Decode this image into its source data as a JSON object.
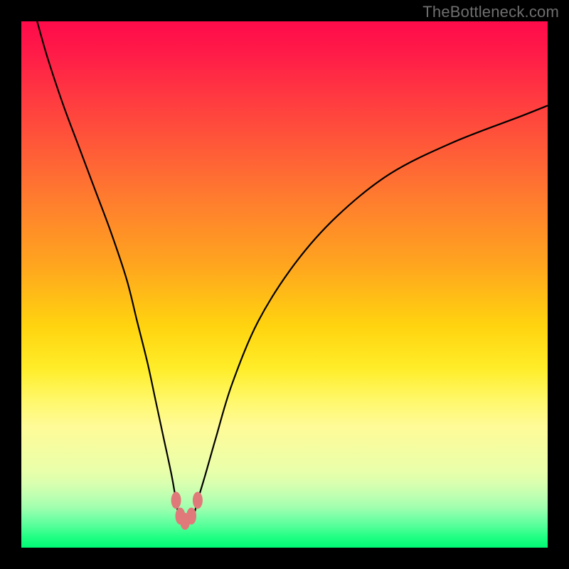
{
  "watermark": "TheBottleneck.com",
  "chart_data": {
    "type": "line",
    "title": "",
    "xlabel": "",
    "ylabel": "",
    "xlim": [
      0,
      100
    ],
    "ylim": [
      0,
      100
    ],
    "series": [
      {
        "name": "bottleneck-curve",
        "x": [
          3,
          5,
          8,
          11,
          14,
          17,
          20,
          22,
          24,
          25.5,
          27,
          28.5,
          29.4,
          30.2,
          32.3,
          33.5,
          35,
          37,
          40,
          45,
          52,
          60,
          70,
          82,
          95,
          100
        ],
        "y": [
          100,
          93,
          84,
          76,
          68,
          60,
          51,
          43,
          35,
          28,
          21,
          14,
          9,
          5,
          5,
          9,
          14,
          21,
          31,
          43,
          54,
          63,
          71,
          77,
          82,
          84
        ]
      }
    ],
    "markers": [
      {
        "name": "min-band-1",
        "x": 29.4,
        "y": 9
      },
      {
        "name": "min-band-2",
        "x": 30.2,
        "y": 6
      },
      {
        "name": "min-band-3",
        "x": 31.1,
        "y": 5
      },
      {
        "name": "min-band-4",
        "x": 32.3,
        "y": 6
      },
      {
        "name": "min-band-5",
        "x": 33.5,
        "y": 9
      }
    ],
    "color_axis": {
      "direction": "vertical",
      "stops": [
        {
          "pos": 0,
          "color": "#ff0a4a",
          "meaning": "high"
        },
        {
          "pos": 50,
          "color": "#ffd40f",
          "meaning": "mid"
        },
        {
          "pos": 100,
          "color": "#00f875",
          "meaning": "low"
        }
      ]
    }
  }
}
